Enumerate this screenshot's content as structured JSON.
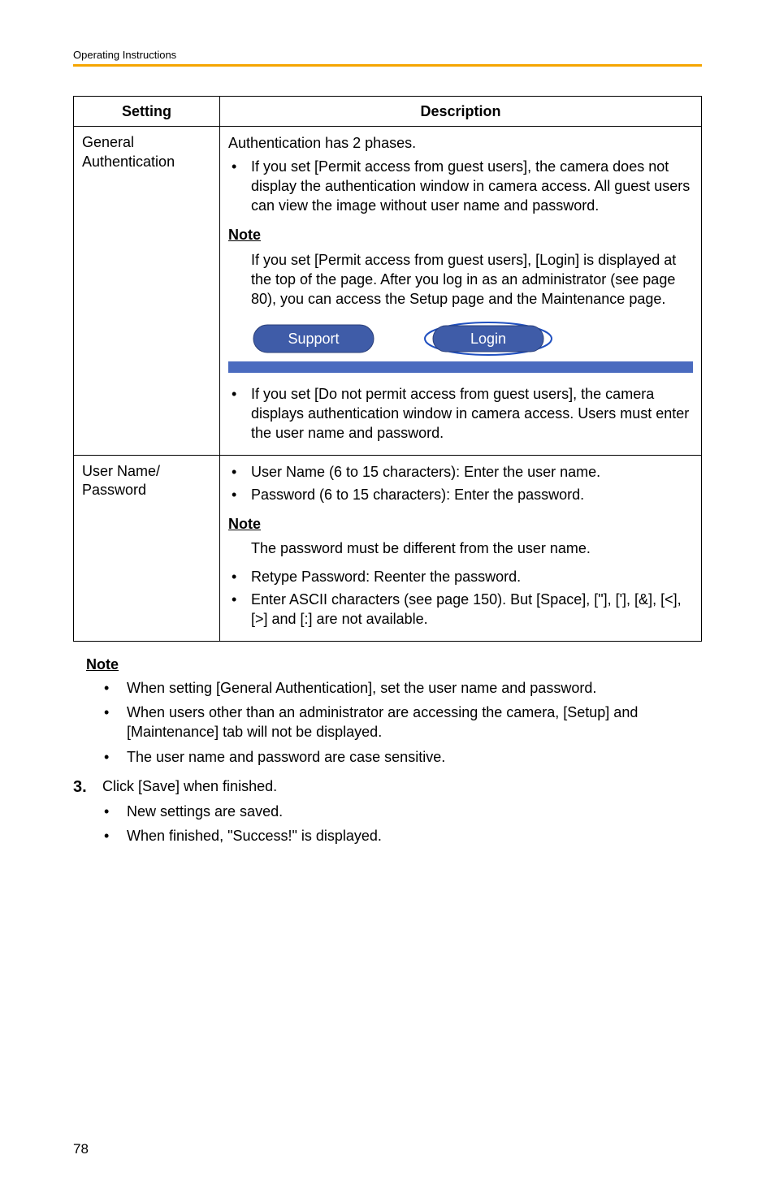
{
  "header": {
    "section": "Operating Instructions"
  },
  "table": {
    "columns": {
      "setting": "Setting",
      "description": "Description"
    },
    "row_general": {
      "label": "General Authentication",
      "intro": "Authentication has 2 phases.",
      "bullet1": "If you set [Permit access from guest users], the camera does not display the authentication window in camera access. All guest users can view the image without user name and password.",
      "note_label": "Note",
      "note_text": "If you set [Permit access from guest users], [Login] is displayed at the top of the page. After you log in as an administrator (see page 80), you can access the Setup page and the Maintenance page.",
      "pill_support": "Support",
      "pill_login": "Login",
      "bullet2": "If you set [Do not permit access from guest users], the camera displays authentication window in camera access. Users must enter the user name and password."
    },
    "row_user": {
      "label": "User Name/\nPassword",
      "bullet1": "User Name (6 to 15 characters): Enter the user name.",
      "bullet2": "Password (6 to 15 characters): Enter the password.",
      "note_label": "Note",
      "note_text": "The password must be different from the user name.",
      "bullet3": "Retype Password: Reenter the password.",
      "bullet4": "Enter ASCII characters (see page 150). But [Space], [\"], ['], [&], [<], [>] and [:] are not available."
    }
  },
  "outer_note": {
    "label": "Note",
    "items": [
      "When setting [General Authentication], set the user name and password.",
      "When users other than an administrator are accessing the camera, [Setup]  and [Maintenance] tab will not be displayed.",
      "The user name and password are case sensitive."
    ]
  },
  "step": {
    "number": "3.",
    "text": "Click [Save] when finished.",
    "sub": [
      "New settings are saved.",
      "When finished, \"Success!\" is displayed."
    ]
  },
  "page_number": "78"
}
